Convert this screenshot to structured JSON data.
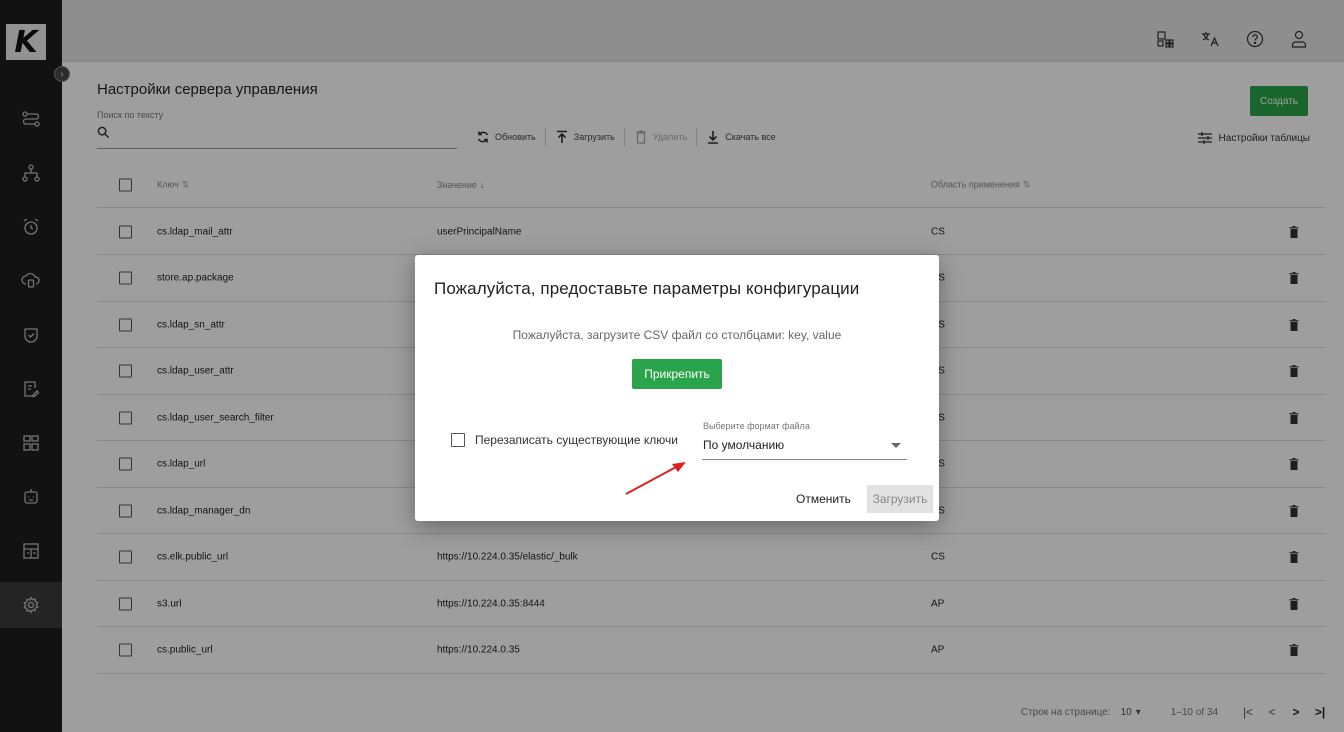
{
  "app": {
    "logo_letter": "K"
  },
  "topbar": {
    "icons": [
      "widgets-icon",
      "translate-icon",
      "help-icon",
      "user-icon"
    ]
  },
  "sidebar": {
    "items": [
      {
        "icon": "route-icon"
      },
      {
        "icon": "hierarchy-icon"
      },
      {
        "icon": "alarm-icon"
      },
      {
        "icon": "cloud-database-icon"
      },
      {
        "icon": "shield-check-icon"
      },
      {
        "icon": "document-edit-icon"
      },
      {
        "icon": "modules-icon"
      },
      {
        "icon": "robot-icon"
      },
      {
        "icon": "spreadsheet-icon"
      },
      {
        "icon": "settings-icon",
        "active": true
      }
    ]
  },
  "page": {
    "title": "Настройки сервера управления",
    "search_label": "Поиск по тексту",
    "create_label": "Создать",
    "toolbar": {
      "refresh": "Обновить",
      "upload": "Загрузить",
      "delete": "Удалить",
      "download_all": "Скачать все"
    },
    "table_settings": "Настройки таблицы"
  },
  "table": {
    "headers": {
      "key": "Ключ",
      "value": "Значение",
      "scope": "Область применения"
    },
    "rows": [
      {
        "key": "cs.ldap_mail_attr",
        "value": "userPrincipalName",
        "scope": "CS"
      },
      {
        "key": "store.ap.package",
        "value": "",
        "scope": "CS"
      },
      {
        "key": "cs.ldap_sn_attr",
        "value": "",
        "scope": "CS"
      },
      {
        "key": "cs.ldap_user_attr",
        "value": "",
        "scope": "CS"
      },
      {
        "key": "cs.ldap_user_search_filter",
        "value": "",
        "scope": "CS"
      },
      {
        "key": "cs.ldap_url",
        "value": "",
        "scope": "CS"
      },
      {
        "key": "cs.ldap_manager_dn",
        "value": "",
        "scope": "CS"
      },
      {
        "key": "cs.elk.public_url",
        "value": "https://10.224.0.35/elastic/_bulk",
        "scope": "CS"
      },
      {
        "key": "s3.url",
        "value": "https://10.224.0.35:8444",
        "scope": "AP"
      },
      {
        "key": "cs.public_url",
        "value": "https://10.224.0.35",
        "scope": "AP"
      }
    ]
  },
  "pagination": {
    "rows_label": "Строк на странице:",
    "rows_value": "10",
    "range": "1–10 of 34",
    "first": "|<",
    "prev": "<",
    "next": ">",
    "last": ">|"
  },
  "dialog": {
    "title": "Пожалуйста, предоставьте параметры конфигурации",
    "message": "Пожалуйста, загрузите CSV файл со столбцами: key, value",
    "attach_label": "Прикрепить",
    "overwrite_label": "Перезаписать существующие ключи",
    "format_label": "Выберите формат файла",
    "format_value": "По умолчанию",
    "cancel_label": "Отменить",
    "upload_label": "Загрузить"
  },
  "colors": {
    "accent_green": "#2aa44a",
    "sidebar_bg": "#1e1e1e",
    "arrow_red": "#e02020"
  }
}
